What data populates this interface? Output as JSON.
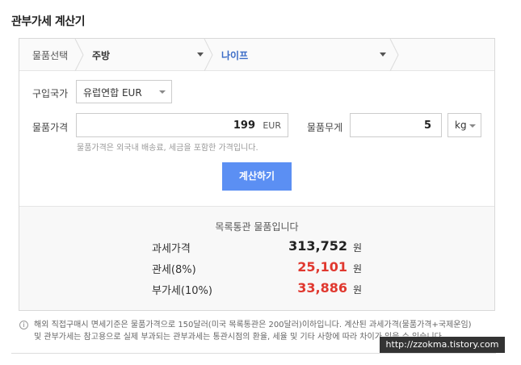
{
  "title": "관부가세 계산기",
  "breadcrumb": {
    "label": "물품선택",
    "category": "주방",
    "item": "나이프"
  },
  "form": {
    "country_label": "구입국가",
    "country_value": "유럽연합 EUR",
    "price_label": "물품가격",
    "price_value": "199",
    "price_currency": "EUR",
    "price_hint": "물품가격은 외국내 배송료, 세금을 포함한 가격입니다.",
    "weight_label": "물품무게",
    "weight_value": "5",
    "weight_unit": "kg",
    "calc_button": "계산하기"
  },
  "result": {
    "heading": "목록통관 물품입니다",
    "rows": [
      {
        "label": "과세가격",
        "value": "313,752",
        "unit": "원",
        "color": "#222222"
      },
      {
        "label": "관세(8%)",
        "value": "25,101",
        "unit": "원",
        "color": "#e0382f"
      },
      {
        "label": "부가세(10%)",
        "value": "33,886",
        "unit": "원",
        "color": "#e0382f"
      }
    ]
  },
  "note": {
    "line1": "해외 직접구매시 면세기준은 물품가격으로 150달러(미국 목록통관은 200달러)이하입니다. 계산된 과세가격(물품가격+국제운임)",
    "line2": "및 관부가세는 참고용으로 실제 부과되는 관부과세는 통관시점의 환율, 세율 및 기타 사항에 따라 차이가 있을 수 있습니다."
  },
  "watermark": "http://zzokma.tistory.com",
  "colors": {
    "accent": "#5b8ff3",
    "selected_item": "#3b6cc7",
    "tax": "#e0382f"
  }
}
